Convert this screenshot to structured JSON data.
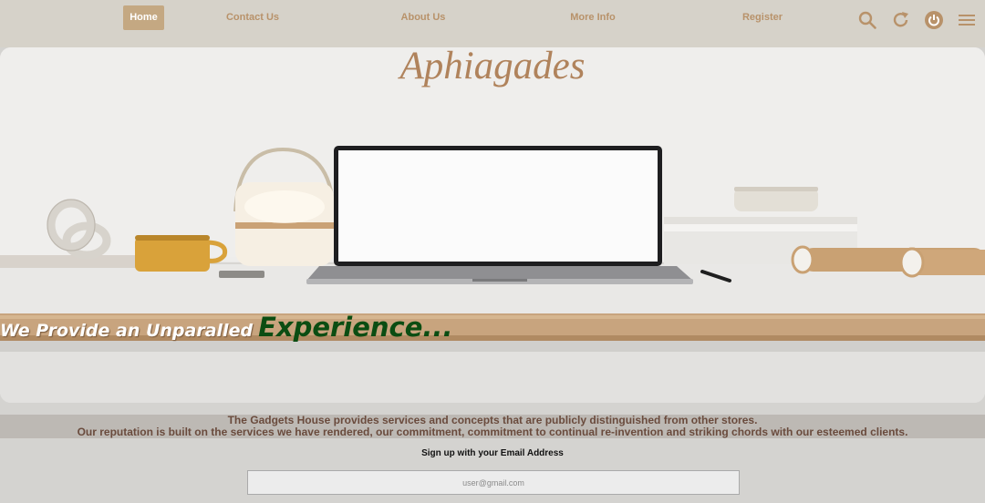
{
  "nav": {
    "links": [
      "Home",
      "Contact Us",
      "About Us",
      "More Info",
      "Register"
    ],
    "active": "Home",
    "icons": [
      "search-icon",
      "refresh-icon",
      "power-icon",
      "menu-icon"
    ],
    "link_color": "#b8926a",
    "active_bg": "#c4a882"
  },
  "hero": {
    "title": "Aphiagades",
    "tagline_part1": "We Provide an Unparalled",
    "tagline_part2": "Experience..."
  },
  "info": {
    "line1": "The Gadgets House provides services and concepts that are publicly distinguished from other stores.",
    "line2": "Our reputation is built on the services we have rendered, our commitment, commitment to continual re-invention and striking chords with our esteemed clients."
  },
  "signup": {
    "label": "Sign up with your Email Address",
    "placeholder": "user@gmail.com"
  }
}
